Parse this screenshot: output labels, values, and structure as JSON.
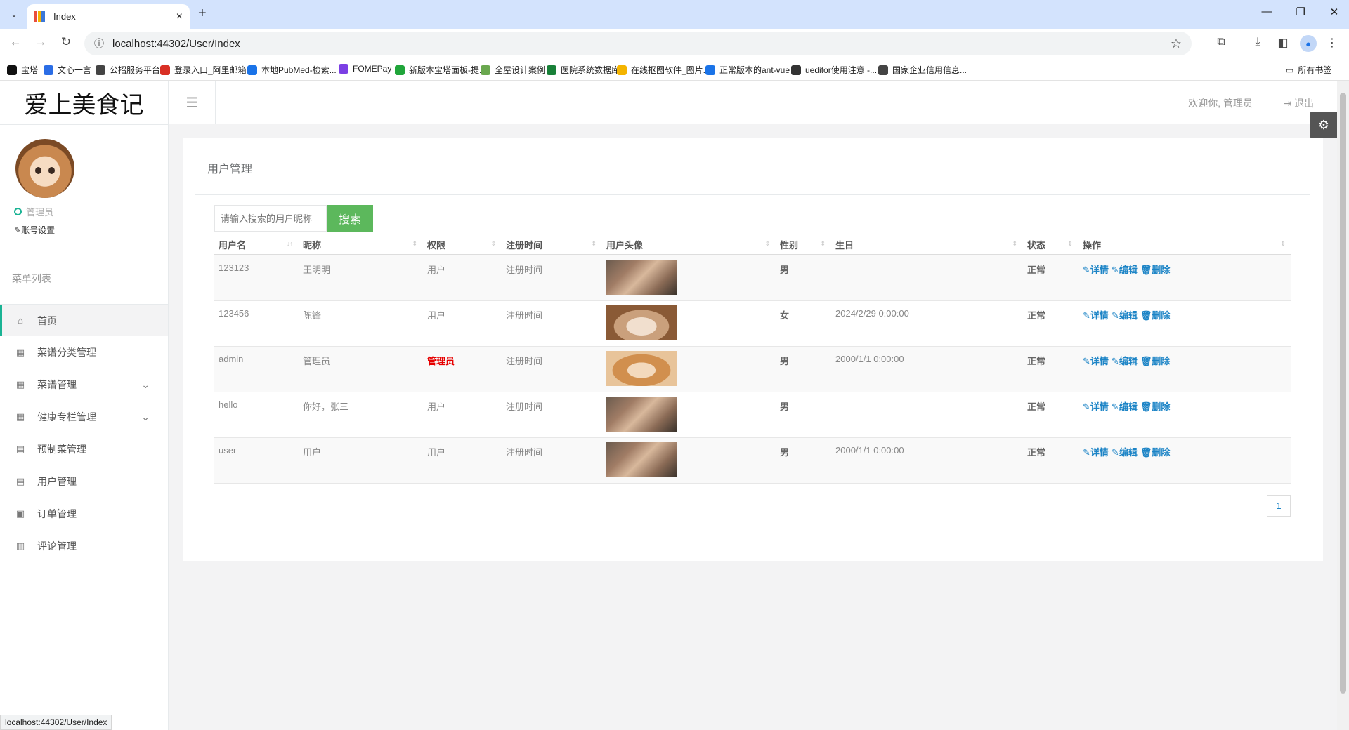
{
  "browser": {
    "tab_title": "Index",
    "url": "localhost:44302/User/Index",
    "status_url": "localhost:44302/User/Index",
    "bookmarks": [
      {
        "label": "宝塔",
        "icon": "bt-icon",
        "color": "#111"
      },
      {
        "label": "文心一言",
        "icon": "wenxin-icon",
        "color": "#2b6de5"
      },
      {
        "label": "公招服务平台",
        "icon": "globe-icon",
        "color": "#444"
      },
      {
        "label": "登录入口_阿里邮箱...",
        "icon": "mail-icon",
        "color": "#d93025"
      },
      {
        "label": "本地PubMed-检索...",
        "icon": "search-q-icon",
        "color": "#1a73e8"
      },
      {
        "label": "FOMEPay",
        "icon": "fomepay-icon",
        "color": "#7b3fe4"
      },
      {
        "label": "新版本宝塔面板-提...",
        "icon": "shield-icon",
        "color": "#20a53a"
      },
      {
        "label": "全屋设计案例",
        "icon": "design-icon",
        "color": "#6aa84f"
      },
      {
        "label": "医院系统数据库",
        "icon": "sheet-icon",
        "color": "#188038"
      },
      {
        "label": "在线抠图软件_图片...",
        "icon": "cutout-icon",
        "color": "#f4b400"
      },
      {
        "label": "正常版本的ant-vue",
        "icon": "vue-icon",
        "color": "#1a73e8"
      },
      {
        "label": "ueditor使用注意 -...",
        "icon": "github-icon",
        "color": "#333"
      },
      {
        "label": "国家企业信用信息...",
        "icon": "globe-icon",
        "color": "#444"
      }
    ],
    "all_bookmarks": "所有书签"
  },
  "app": {
    "logo": "爱上美食记",
    "role": "管理员",
    "account_settings": "账号设置",
    "menu_title": "菜单列表",
    "menu": [
      {
        "label": "首页",
        "icon": "home-icon",
        "active": true
      },
      {
        "label": "菜谱分类管理",
        "icon": "table-icon"
      },
      {
        "label": "菜谱管理",
        "icon": "table-icon",
        "caret": true
      },
      {
        "label": "健康专栏管理",
        "icon": "table-icon",
        "caret": true
      },
      {
        "label": "预制菜管理",
        "icon": "calendar-icon"
      },
      {
        "label": "用户管理",
        "icon": "calendar-icon"
      },
      {
        "label": "订单管理",
        "icon": "list-alt-icon"
      },
      {
        "label": "评论管理",
        "icon": "bar-chart-icon"
      }
    ],
    "welcome": "欢迎你, 管理员",
    "logout": "退出"
  },
  "main": {
    "title": "用户管理",
    "search_placeholder": "请输入搜索的用户昵称",
    "search_button": "搜索",
    "columns": [
      "用户名",
      "昵称",
      "权限",
      "注册时间",
      "用户头像",
      "性别",
      "生日",
      "状态",
      "操作"
    ],
    "rows": [
      {
        "username": "123123",
        "nickname": "王明明",
        "role": "用户",
        "reg": "注册时间",
        "avatar": "man",
        "gender": "男",
        "birthday": "",
        "status": "正常"
      },
      {
        "username": "123456",
        "nickname": "陈锋",
        "role": "用户",
        "reg": "注册时间",
        "avatar": "cat",
        "gender": "女",
        "birthday": "2024/2/29 0:00:00",
        "status": "正常"
      },
      {
        "username": "admin",
        "nickname": "管理员",
        "role": "管理员",
        "reg": "注册时间",
        "avatar": "lion",
        "gender": "男",
        "birthday": "2000/1/1 0:00:00",
        "status": "正常"
      },
      {
        "username": "hello",
        "nickname": "你好，张三",
        "role": "用户",
        "reg": "注册时间",
        "avatar": "man",
        "gender": "男",
        "birthday": "",
        "status": "正常"
      },
      {
        "username": "user",
        "nickname": "用户",
        "role": "用户",
        "reg": "注册时间",
        "avatar": "man",
        "gender": "男",
        "birthday": "2000/1/1 0:00:00",
        "status": "正常"
      }
    ],
    "actions": {
      "detail": "详情",
      "edit": "编辑",
      "delete": "删除"
    },
    "page": "1"
  }
}
